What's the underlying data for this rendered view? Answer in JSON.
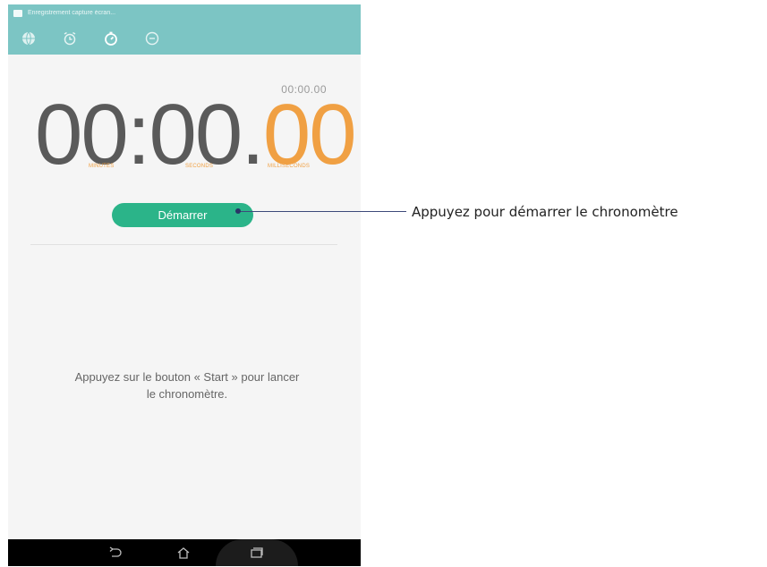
{
  "status_bar": {
    "text": "Enregistrement capture écran..."
  },
  "tabs": [
    {
      "icon": "globe-icon",
      "label": "world-clock"
    },
    {
      "icon": "alarm-clock-icon",
      "label": "alarm"
    },
    {
      "icon": "stopwatch-icon",
      "label": "stopwatch",
      "active": true
    },
    {
      "icon": "timer-icon",
      "label": "timer"
    }
  ],
  "stopwatch": {
    "small_time": "00:00.00",
    "main_time": "00:00.",
    "main_ms": "00",
    "labels": {
      "minutes": "MINUTES",
      "seconds": "SECONDS",
      "milliseconds": "MILLISECONDS"
    },
    "start_label": "Démarrer"
  },
  "hint": {
    "line1": "Appuyez sur le bouton « Start » pour lancer",
    "line2": "le chronomètre."
  },
  "callout": {
    "text": "Appuyez pour démarrer le chronomètre"
  },
  "nav": {
    "back": "back-icon",
    "home": "home-icon",
    "recents": "recents-icon"
  },
  "colors": {
    "teal_bar": "#7cc5c4",
    "start_button": "#2bb489",
    "accent_orange": "#f0a043",
    "digits_gray": "#5a5a5a"
  }
}
